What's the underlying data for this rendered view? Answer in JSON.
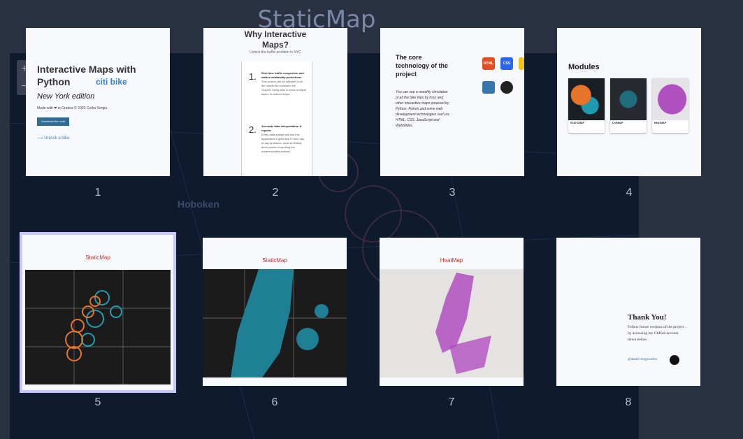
{
  "background": {
    "title": "StaticMap",
    "map_label": "Hoboken",
    "zoom_in": "+",
    "zoom_out": "−"
  },
  "slides": [
    {
      "number": "1",
      "title": "Interactive Maps with Python",
      "brand": "citi bike",
      "edition": "New York edition",
      "made": "Made with ❤ in Oradea © 2020 Corbu Sergiu",
      "button": "Download the code",
      "link": "Unlock a bike"
    },
    {
      "number": "2",
      "title": "Why Interactive Maps?",
      "subtitle": "Unlock the traffic problem in NYC",
      "points": [
        {
          "n": "1.",
          "head": "Real time traffic congestion and station availability predictions",
          "body": "This project can be adapted to all the needs the customer will request, being able to show multiple layers in custom maps."
        },
        {
          "n": "2.",
          "head": "Accurate data interpretation & reports",
          "body": "Every data analyst will find this application a great tool in their day to day problems, such as finding block-points or spotting the underexploited stations."
        }
      ]
    },
    {
      "number": "3",
      "title": "The core technology of the project",
      "body": "You can see a monthly simulation of all the bike trips by hour and other interactive maps powered by Python, Folium and some web development technologies such as HTML, CSS, JavaScript and WebSlides.",
      "icons": [
        "html5-icon",
        "css3-icon",
        "python-icon",
        "github-icon"
      ],
      "icon_labels": [
        "HTML",
        "CSS"
      ]
    },
    {
      "number": "4",
      "title": "Modules",
      "modules": [
        "STATICMAP",
        "LIVEMAP",
        "HEATMAP"
      ]
    },
    {
      "number": "5",
      "title": "StaticMap"
    },
    {
      "number": "6",
      "title": "StaticMap"
    },
    {
      "number": "7",
      "title": "HeatMap"
    },
    {
      "number": "8",
      "title": "Thank You!",
      "body": "Follow future versions of the project by accessing my GitHub account down below:",
      "handle": "@daniel-sergiucorbu"
    }
  ],
  "colors": {
    "orange": "#e8742a",
    "teal": "#1f9bb0",
    "heat": "#b04fc0",
    "selected": "#c7c8f7"
  }
}
